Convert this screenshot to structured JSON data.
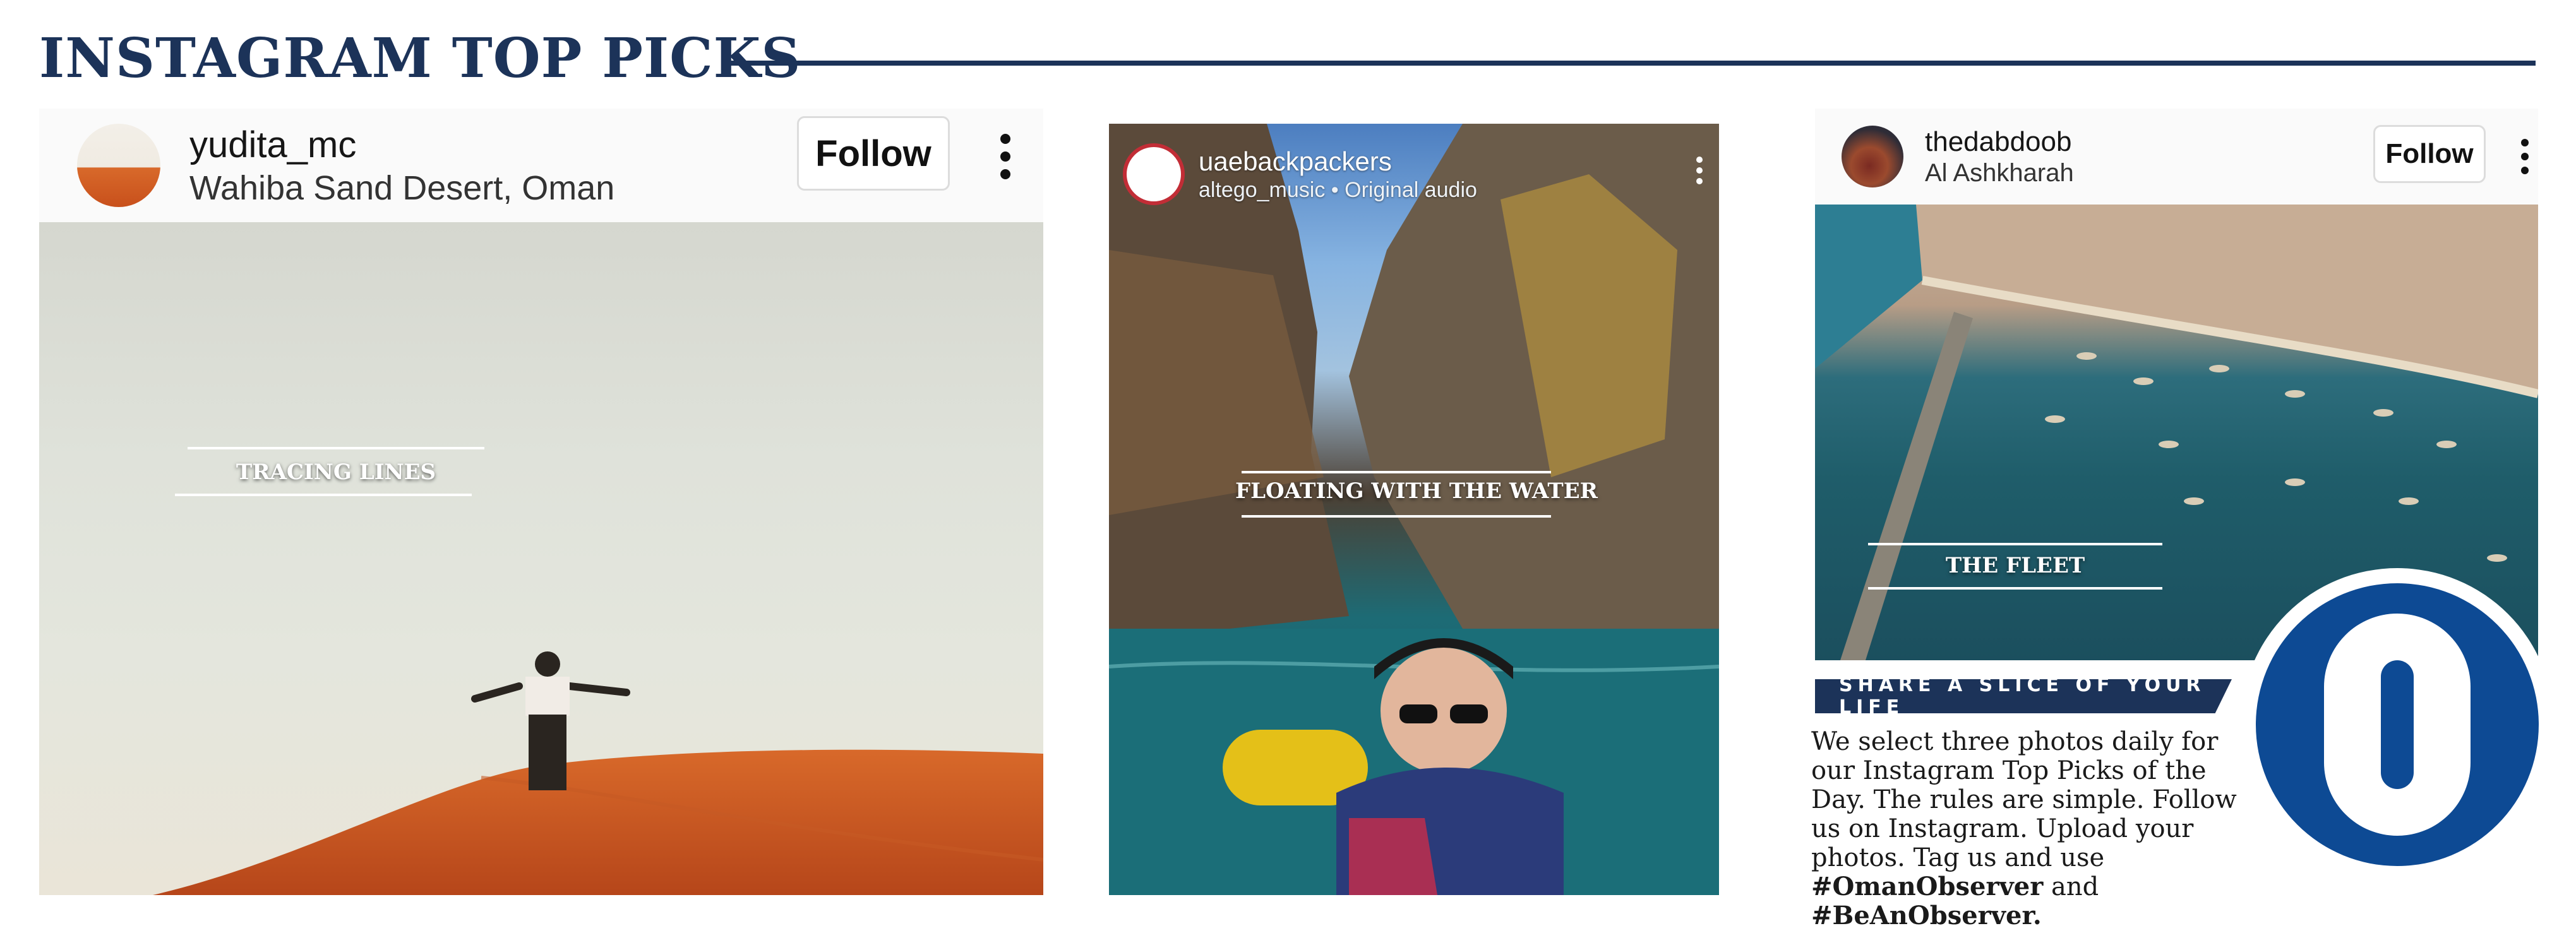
{
  "header": {
    "title": "INSTAGRAM TOP PICKS"
  },
  "posts": [
    {
      "username": "yudita_mc",
      "location": "Wahiba Sand Desert, Oman",
      "follow_label": "Follow",
      "caption": "TRACING LINES",
      "more_icon": "vertical-ellipsis-icon"
    },
    {
      "username": "uaebackpackers",
      "subtitle": "altego_music • Original audio",
      "caption": "FLOATING WITH THE WATER",
      "more_icon": "vertical-ellipsis-icon"
    },
    {
      "username": "thedabdoob",
      "location": "Al Ashkharah",
      "follow_label": "Follow",
      "caption": "THE FLEET",
      "more_icon": "vertical-ellipsis-icon"
    }
  ],
  "share": {
    "heading": "SHARE A SLICE OF YOUR LIFE",
    "body_lines": [
      "We select three photos daily for",
      "our Instagram Top Picks of the",
      "Day. The rules are simple. Follow",
      "us on Instagram. Upload your",
      "photos. Tag us and use"
    ],
    "tag1": "#OmanObserver",
    "and_text": " and ",
    "tag2": "#BeAnObserver."
  },
  "logo": {
    "letter": "O",
    "color": "#0d4a94"
  },
  "colors": {
    "brand_navy": "#1c3359",
    "logo_blue": "#0d4a94",
    "sand": "#c8501c"
  }
}
